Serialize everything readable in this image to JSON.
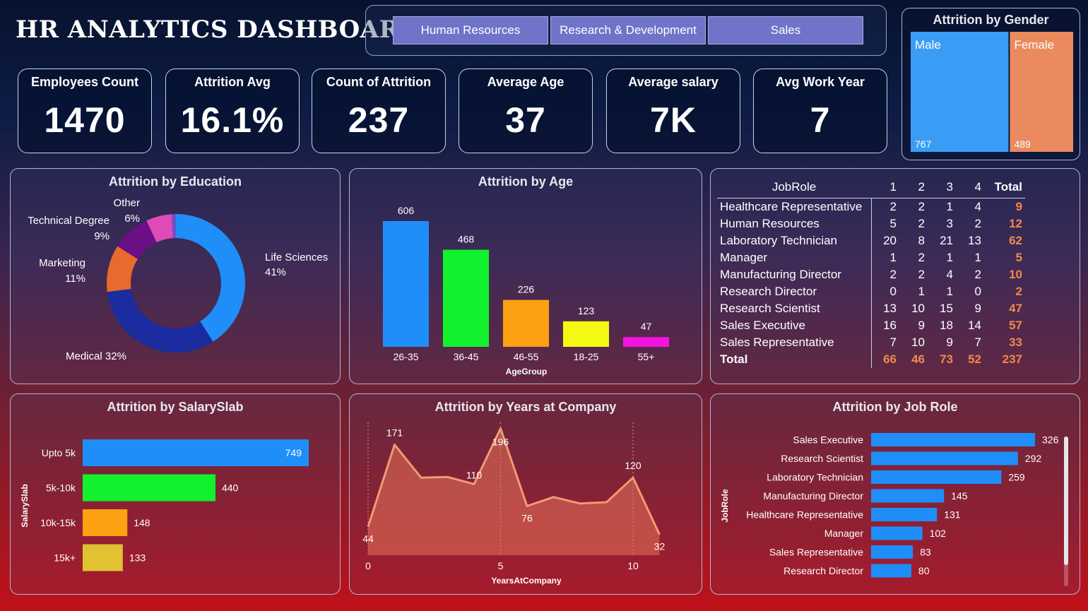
{
  "title": "HR ANALYTICS DASHBOARD",
  "departments": [
    "Human Resources",
    "Research & Development",
    "Sales"
  ],
  "kpis": [
    {
      "label": "Employees Count",
      "value": "1470"
    },
    {
      "label": "Attrition Avg",
      "value": "16.1%"
    },
    {
      "label": "Count of Attrition",
      "value": "237"
    },
    {
      "label": "Average Age",
      "value": "37"
    },
    {
      "label": "Average salary",
      "value": "7K"
    },
    {
      "label": "Avg Work Year",
      "value": "7"
    }
  ],
  "gender": {
    "title": "Attrition by Gender",
    "items": [
      {
        "label": "Male",
        "value": 767,
        "color": "#3a9df5"
      },
      {
        "label": "Female",
        "value": 489,
        "color": "#ea8a5e"
      }
    ]
  },
  "education": {
    "title": "Attrition by Education",
    "slices": [
      {
        "label": "Life Sciences",
        "pct": "41%",
        "value": 41,
        "color": "#1f8ef8"
      },
      {
        "label": "Medical",
        "pct": "32%",
        "value": 32,
        "color": "#1a2ca0"
      },
      {
        "label": "Marketing",
        "pct": "11%",
        "value": 11,
        "color": "#e86a2c"
      },
      {
        "label": "Technical Degree",
        "pct": "9%",
        "value": 9,
        "color": "#6b0f85"
      },
      {
        "label": "Other",
        "pct": "6%",
        "value": 6,
        "color": "#e04ab6"
      },
      {
        "label": "",
        "pct": "",
        "value": 1,
        "color": "#6a54c9"
      }
    ]
  },
  "age": {
    "title": "Attrition by Age",
    "xlabel": "AgeGroup",
    "categories": [
      "26-35",
      "36-45",
      "46-55",
      "18-25",
      "55+"
    ],
    "values": [
      606,
      468,
      226,
      123,
      47
    ],
    "colors": [
      "#1f8ef8",
      "#12f12d",
      "#fda012",
      "#f3f912",
      "#f314e0"
    ]
  },
  "matrix": {
    "header": [
      "JobRole",
      "1",
      "2",
      "3",
      "4",
      "Total"
    ],
    "rows": [
      [
        "Healthcare Representative",
        "2",
        "2",
        "1",
        "4",
        "9"
      ],
      [
        "Human Resources",
        "5",
        "2",
        "3",
        "2",
        "12"
      ],
      [
        "Laboratory Technician",
        "20",
        "8",
        "21",
        "13",
        "62"
      ],
      [
        "Manager",
        "1",
        "2",
        "1",
        "1",
        "5"
      ],
      [
        "Manufacturing Director",
        "2",
        "2",
        "4",
        "2",
        "10"
      ],
      [
        "Research Director",
        "0",
        "1",
        "1",
        "0",
        "2"
      ],
      [
        "Research Scientist",
        "13",
        "10",
        "15",
        "9",
        "47"
      ],
      [
        "Sales Executive",
        "16",
        "9",
        "18",
        "14",
        "57"
      ],
      [
        "Sales Representative",
        "7",
        "10",
        "9",
        "7",
        "33"
      ]
    ],
    "total": [
      "Total",
      "66",
      "46",
      "73",
      "52",
      "237"
    ]
  },
  "salary": {
    "title": "Attrition by SalarySlab",
    "ylabel": "SalarySlab",
    "categories": [
      "Upto 5k",
      "5k-10k",
      "10k-15k",
      "15k+"
    ],
    "values": [
      749,
      440,
      148,
      133
    ],
    "colors": [
      "#1f8ef8",
      "#12f12d",
      "#fda012",
      "#e0c232"
    ]
  },
  "years": {
    "title": "Attrition by Years at Company",
    "xlabel": "YearsAtCompany",
    "x": [
      0,
      1,
      2,
      3,
      4,
      5,
      6,
      7,
      8,
      9,
      10,
      11
    ],
    "y": [
      44,
      171,
      120,
      121,
      110,
      196,
      76,
      90,
      80,
      82,
      120,
      32
    ],
    "labeled": {
      "0": 44,
      "1": 171,
      "4": 110,
      "5": 196,
      "6": 76,
      "10": 120,
      "11": 32
    },
    "xticks": [
      0,
      5,
      10
    ]
  },
  "jobrole": {
    "title": "Attrition by Job Role",
    "ylabel": "JobRole",
    "categories": [
      "Sales Executive",
      "Research Scientist",
      "Laboratory Technician",
      "Manufacturing Director",
      "Healthcare Representative",
      "Manager",
      "Sales Representative",
      "Research Director"
    ],
    "values": [
      326,
      292,
      259,
      145,
      131,
      102,
      83,
      80
    ],
    "color": "#1f8ef8"
  }
}
